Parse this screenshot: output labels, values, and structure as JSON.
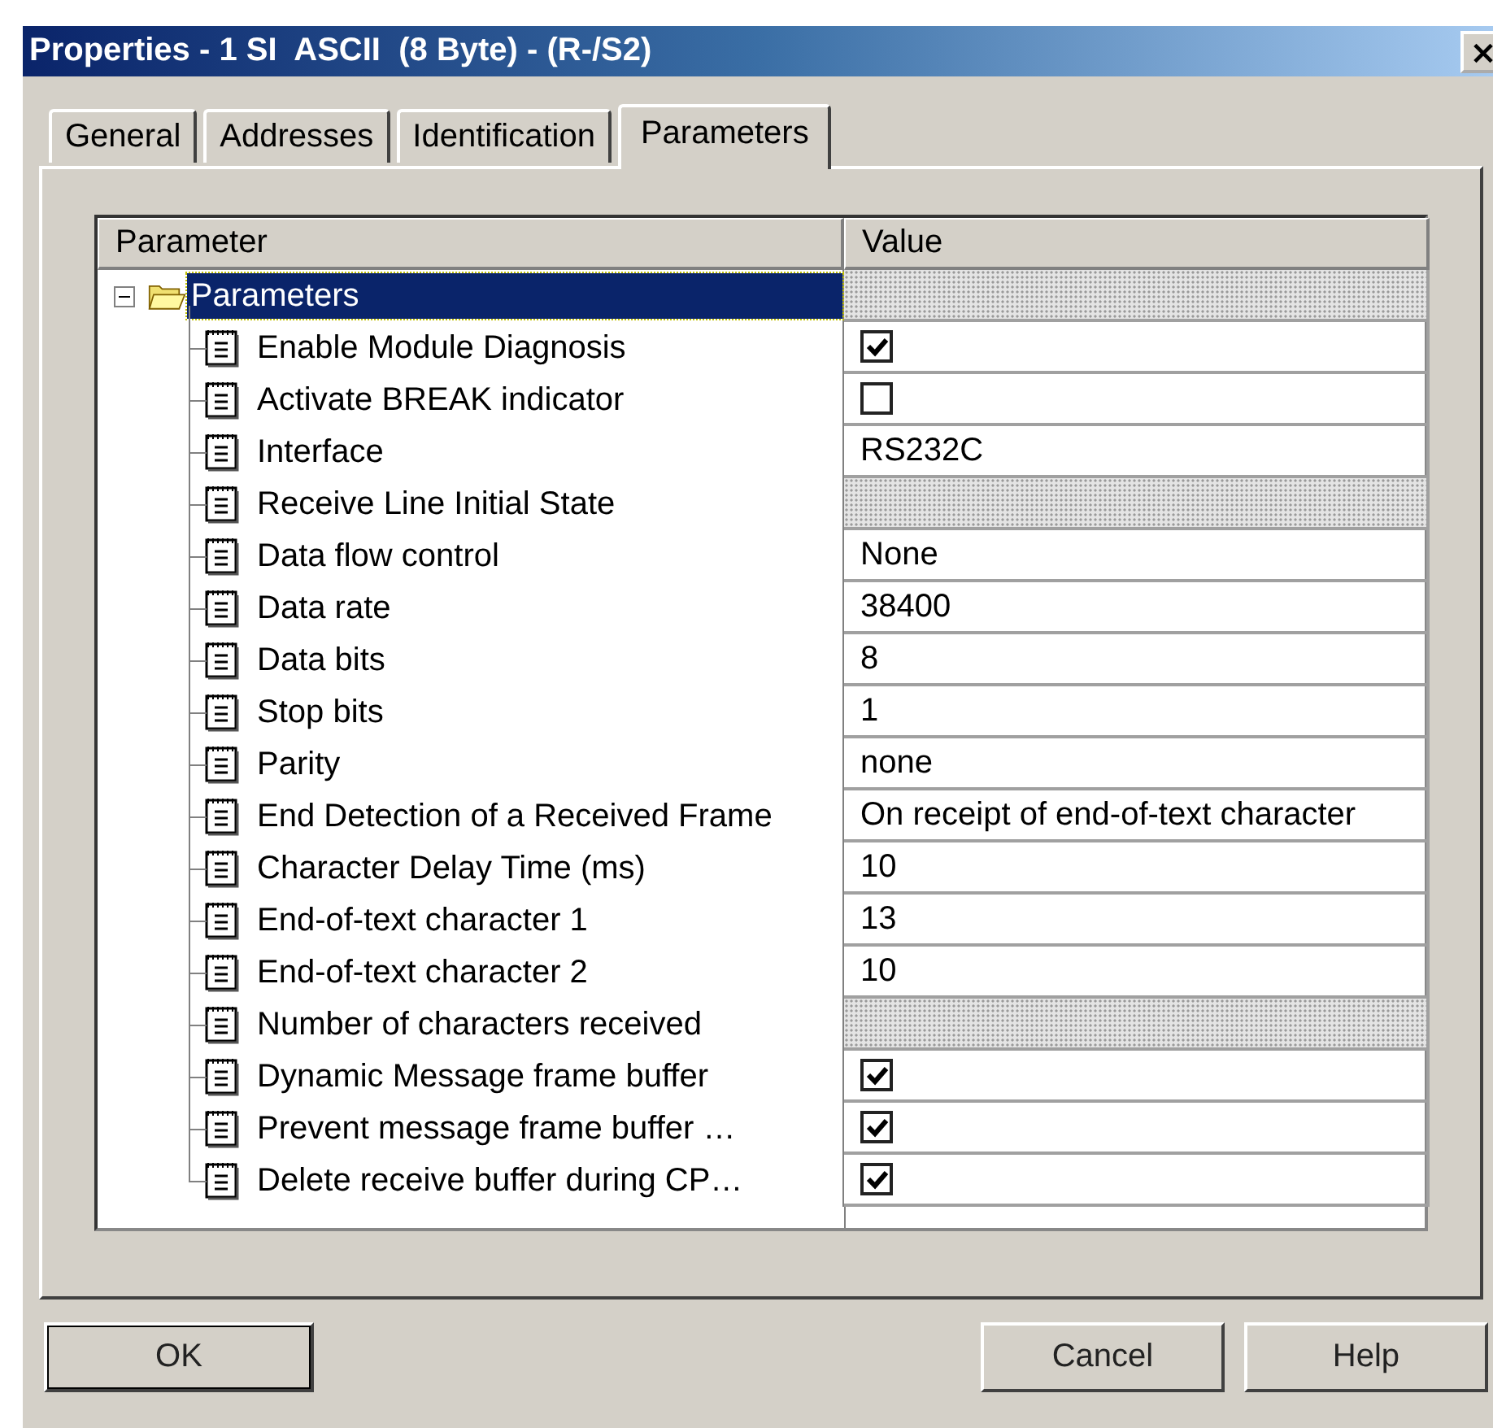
{
  "window": {
    "title": "Properties - 1 SI  ASCII  (8 Byte) - (R-/S2)",
    "close": "×"
  },
  "tabs": [
    {
      "label": "General",
      "selected": false
    },
    {
      "label": "Addresses",
      "selected": false
    },
    {
      "label": "Identification",
      "selected": false
    },
    {
      "label": "Parameters",
      "selected": true
    }
  ],
  "table": {
    "columns": [
      "Parameter",
      "Value"
    ],
    "tree": [
      {
        "label": "Parameters",
        "selected": true,
        "expanded": true,
        "kind": "empty",
        "children": [
          {
            "label": "Enable Module Diagnosis",
            "kind": "checkbox",
            "checked": true
          },
          {
            "label": "Activate BREAK indicator",
            "kind": "checkbox",
            "checked": false
          },
          {
            "label": "Interface",
            "kind": "text",
            "value": "RS232C"
          },
          {
            "label": "Receive Line Initial State",
            "kind": "empty"
          },
          {
            "label": "Data flow control",
            "kind": "text",
            "value": "None"
          },
          {
            "label": "Data rate",
            "kind": "text",
            "value": "38400"
          },
          {
            "label": "Data bits",
            "kind": "text",
            "value": "8"
          },
          {
            "label": "Stop bits",
            "kind": "text",
            "value": "1"
          },
          {
            "label": "Parity",
            "kind": "text",
            "value": "none"
          },
          {
            "label": "End Detection of a Received Frame",
            "kind": "text",
            "value": "On receipt of end-of-text character"
          },
          {
            "label": "Character Delay Time (ms)",
            "kind": "text",
            "value": "10"
          },
          {
            "label": "End-of-text character 1",
            "kind": "text",
            "value": "13"
          },
          {
            "label": "End-of-text character 2",
            "kind": "text",
            "value": "10"
          },
          {
            "label": "Number of characters received",
            "kind": "empty"
          },
          {
            "label": "Dynamic Message frame buffer",
            "kind": "checkbox",
            "checked": true
          },
          {
            "label": "Prevent message frame buffer …",
            "kind": "checkbox",
            "checked": true
          },
          {
            "label": "Delete receive buffer during CP…",
            "kind": "checkbox",
            "checked": true
          }
        ]
      }
    ]
  },
  "buttons": [
    {
      "label": "OK",
      "kind": "ok"
    },
    {
      "label": "Cancel",
      "kind": "cancel"
    },
    {
      "label": "Help",
      "kind": "help"
    }
  ]
}
